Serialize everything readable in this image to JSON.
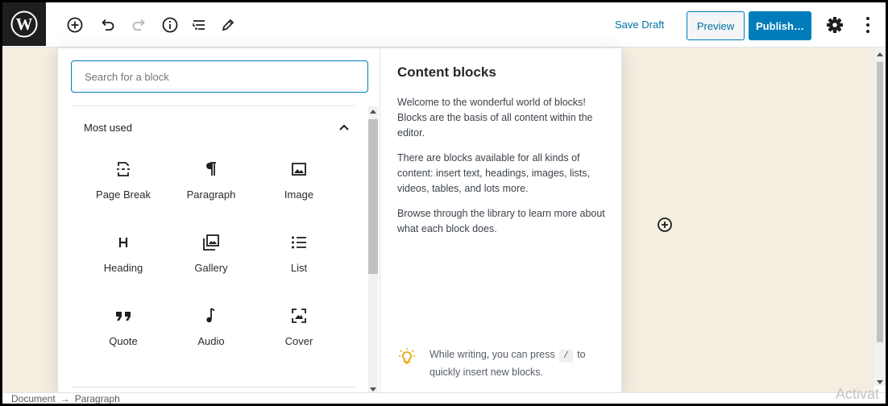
{
  "toolbar": {
    "save_draft": "Save Draft",
    "preview": "Preview",
    "publish": "Publish…",
    "accent_color": "#007cba"
  },
  "inserter": {
    "search_placeholder": "Search for a block",
    "panel_title": "Most used",
    "blocks": [
      {
        "label": "Page Break",
        "icon": "page-break-icon"
      },
      {
        "label": "Paragraph",
        "icon": "paragraph-icon"
      },
      {
        "label": "Image",
        "icon": "image-icon"
      },
      {
        "label": "Heading",
        "icon": "heading-icon"
      },
      {
        "label": "Gallery",
        "icon": "gallery-icon"
      },
      {
        "label": "List",
        "icon": "list-icon"
      },
      {
        "label": "Quote",
        "icon": "quote-icon"
      },
      {
        "label": "Audio",
        "icon": "audio-icon"
      },
      {
        "label": "Cover",
        "icon": "cover-icon"
      }
    ],
    "help": {
      "title": "Content blocks",
      "p1": "Welcome to the wonderful world of blocks! Blocks are the basis of all content within the editor.",
      "p2": "There are blocks available for all kinds of content: insert text, headings, images, lists, videos, tables, and lots more.",
      "p3": "Browse through the library to learn more about what each block does.",
      "tip_before": "While writing, you can press",
      "tip_key": "/",
      "tip_after": "to quickly insert new blocks."
    }
  },
  "footer": {
    "breadcrumb_root": "Document",
    "breadcrumb_arrow": "→",
    "breadcrumb_current": "Paragraph"
  },
  "watermark": "Activat",
  "canvas_color": "#f3eee0"
}
